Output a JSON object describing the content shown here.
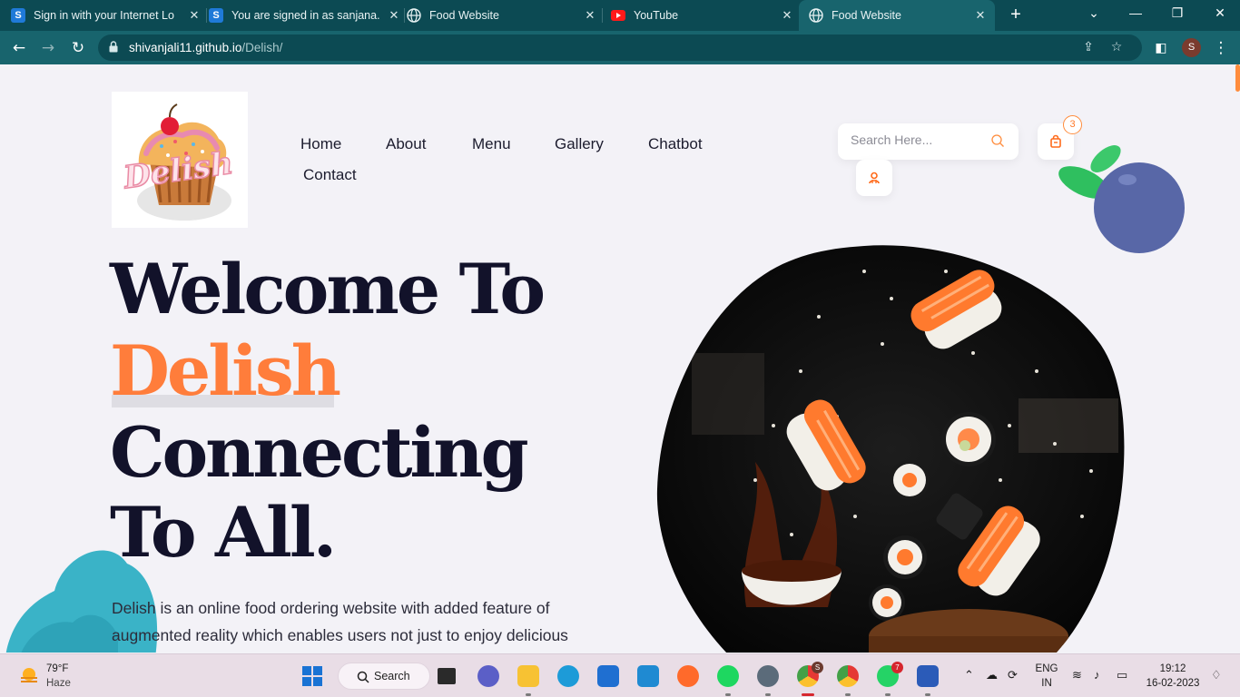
{
  "browser": {
    "tabs": [
      {
        "label": "Sign in with your Internet Lo",
        "favicon": "s-icon"
      },
      {
        "label": "You are signed in as sanjana.",
        "favicon": "s-icon"
      },
      {
        "label": "Food Website",
        "favicon": "globe-icon"
      },
      {
        "label": "YouTube",
        "favicon": "youtube-icon"
      },
      {
        "label": "Food Website",
        "favicon": "globe-icon",
        "active": true
      }
    ],
    "new_tab": "+",
    "url_host": "shivanjali11.github.io",
    "url_path": "/Delish/",
    "profile_initial": "S"
  },
  "site": {
    "nav": [
      "Home",
      "About",
      "Menu",
      "Gallery",
      "Chatbot",
      "Contact"
    ],
    "search_placeholder": "Search Here...",
    "cart_count": "3",
    "hero": {
      "line1": "Welcome To",
      "line2": "Delish",
      "line3": "Connecting",
      "line4": "To All."
    },
    "description": "Delish is an online food ordering website with added feature of augmented reality which enables users not just to enjoy delicious",
    "logo_text": "Delish",
    "accent_color": "#ff7d3b"
  },
  "taskbar": {
    "weather_temp": "79°F",
    "weather_desc": "Haze",
    "search_label": "Search",
    "lang_top": "ENG",
    "lang_bottom": "IN",
    "time": "19:12",
    "date": "16-02-2023",
    "chrome_badge": "S",
    "whatsapp_badge": "7"
  }
}
